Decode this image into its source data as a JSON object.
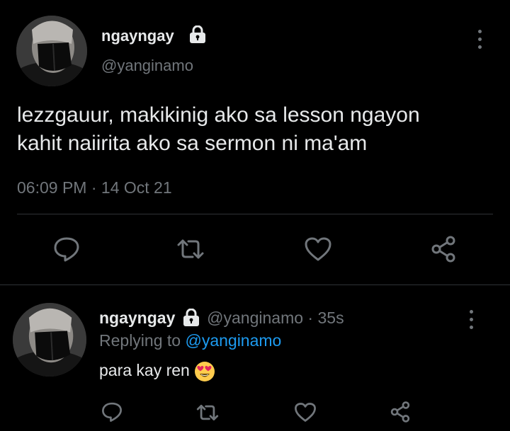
{
  "main_tweet": {
    "display_name": "ngayngay",
    "handle": "@yanginamo",
    "text_line1": "lezzgauur, makikinig ako sa lesson ngayon",
    "text_line2": "kahit naiirita ako sa sermon ni ma'am",
    "time": "06:09 PM",
    "dot": "·",
    "date": "14 Oct 21"
  },
  "reply": {
    "display_name": "ngayngay",
    "handle": "@yanginamo",
    "dot": "·",
    "age": "35s",
    "replying_prefix": "Replying to",
    "replying_to": "@yanginamo",
    "text": "para kay ren",
    "emoji": "heart-eyes-emoji"
  },
  "icons": {
    "lock": "lock-icon",
    "more": "more-icon",
    "reply": "reply-icon",
    "retweet": "retweet-icon",
    "like": "heart-icon",
    "share": "share-icon"
  },
  "colors": {
    "background": "#000000",
    "text": "#e7e9ea",
    "secondary": "#71767b",
    "link": "#1d9bf0",
    "divider": "#2f3336"
  }
}
